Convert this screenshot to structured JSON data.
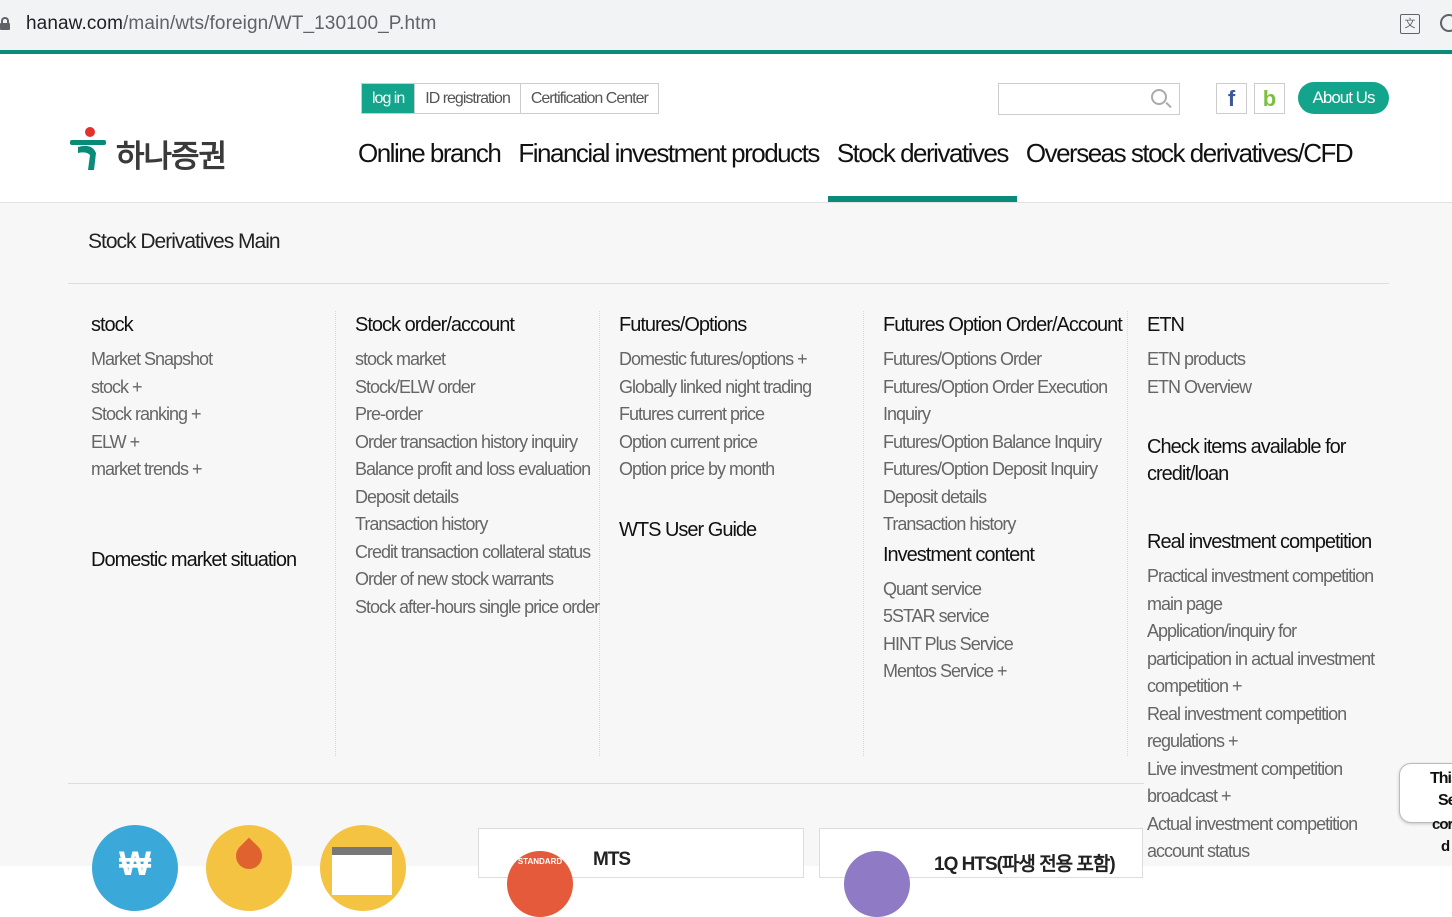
{
  "browser": {
    "url_domain": "hanaw.com",
    "url_path": "/main/wts/foreign/WT_130100_P.htm"
  },
  "header": {
    "logo_text": "하나증권",
    "util_links": [
      "log in",
      "ID registration",
      "Certification Center"
    ],
    "search": {
      "value": "",
      "placeholder": ""
    },
    "facebook_label": "f",
    "blog_label": "b",
    "about_label": "About Us",
    "nav": [
      {
        "label": "Online branch",
        "active": false
      },
      {
        "label": "Financial investment products",
        "active": false
      },
      {
        "label": "Stock derivatives",
        "active": true
      },
      {
        "label": "Overseas stock derivatives/CFD",
        "active": false
      }
    ]
  },
  "mega_menu": {
    "title": "Stock Derivatives Main",
    "col1": {
      "heading": "stock",
      "items": [
        "Market Snapshot",
        "stock +",
        "Stock ranking +",
        "ELW +",
        "market trends +"
      ],
      "heading2": "Domestic market situation"
    },
    "col2": {
      "heading": "Stock order/account",
      "items": [
        "stock market",
        "Stock/ELW order",
        "Pre-order",
        "Order transaction history inquiry",
        "Balance profit and loss evaluation",
        "Deposit details",
        "Transaction history",
        "Credit transaction collateral status",
        "Order of new stock warrants",
        "Stock after-hours single price order"
      ]
    },
    "col3": {
      "heading": "Futures/Options",
      "items": [
        "Domestic futures/options +",
        "Globally linked night trading",
        "Futures current price",
        "Option current price",
        "Option price by month"
      ],
      "heading2": "WTS User Guide"
    },
    "col4": {
      "heading": "Futures Option Order/Account",
      "items": [
        "Futures/Options Order",
        "Futures/Option Order Execution",
        "Inquiry",
        "Futures/Option Balance Inquiry",
        "Futures/Option Deposit Inquiry",
        "Deposit details",
        "Transaction history"
      ],
      "heading2": "Investment content",
      "items2": [
        "Quant service",
        "5STAR service",
        "HINT Plus Service",
        "Mentos Service +"
      ]
    },
    "col5": {
      "heading": "ETN",
      "items": [
        "ETN products",
        "ETN Overview"
      ],
      "heading2_line1": "Check items available for",
      "heading2_line2": "credit/loan",
      "heading3": "Real investment competition",
      "items3": [
        "Practical investment competition",
        "main page",
        "Application/inquiry for",
        "participation in actual investment",
        "competition +",
        "Real investment competition",
        "regulations +",
        "Live investment competition",
        "broadcast +",
        "Actual investment competition",
        "account status"
      ]
    }
  },
  "shortcuts": {
    "circle1_label": "₩",
    "card1_badge": "STANDARD",
    "card1_title": "MTS",
    "card2_title": "1Q HTS(파생 전용 포함)"
  },
  "tip": {
    "line1": "This",
    "line2": "Se",
    "line3": "cor",
    "line4": "d"
  }
}
